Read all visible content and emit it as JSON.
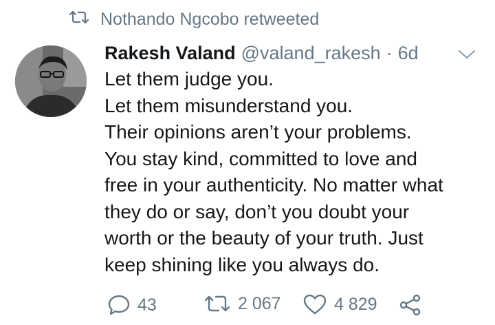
{
  "retweet_context": {
    "icon": "retweet-icon",
    "text": "Nothando Ngcobo retweeted"
  },
  "tweet": {
    "author_name": "Rakesh Valand",
    "handle": "@valand_rakesh",
    "separator": "·",
    "time": "6d",
    "lines": [
      "Let them judge you.",
      "Let them misunderstand you.",
      "Their opinions aren’t your problems.",
      "You stay kind, committed to love and",
      "free in your authenticity. No matter what",
      "they do or say, don’t you doubt your",
      "worth or the beauty of your truth. Just",
      "keep shining like you always do."
    ]
  },
  "actions": {
    "reply_count": "43",
    "retweet_count": "2 067",
    "like_count": "4 829"
  },
  "colors": {
    "text": "#14171a",
    "muted": "#657786",
    "background": "#ffffff"
  }
}
